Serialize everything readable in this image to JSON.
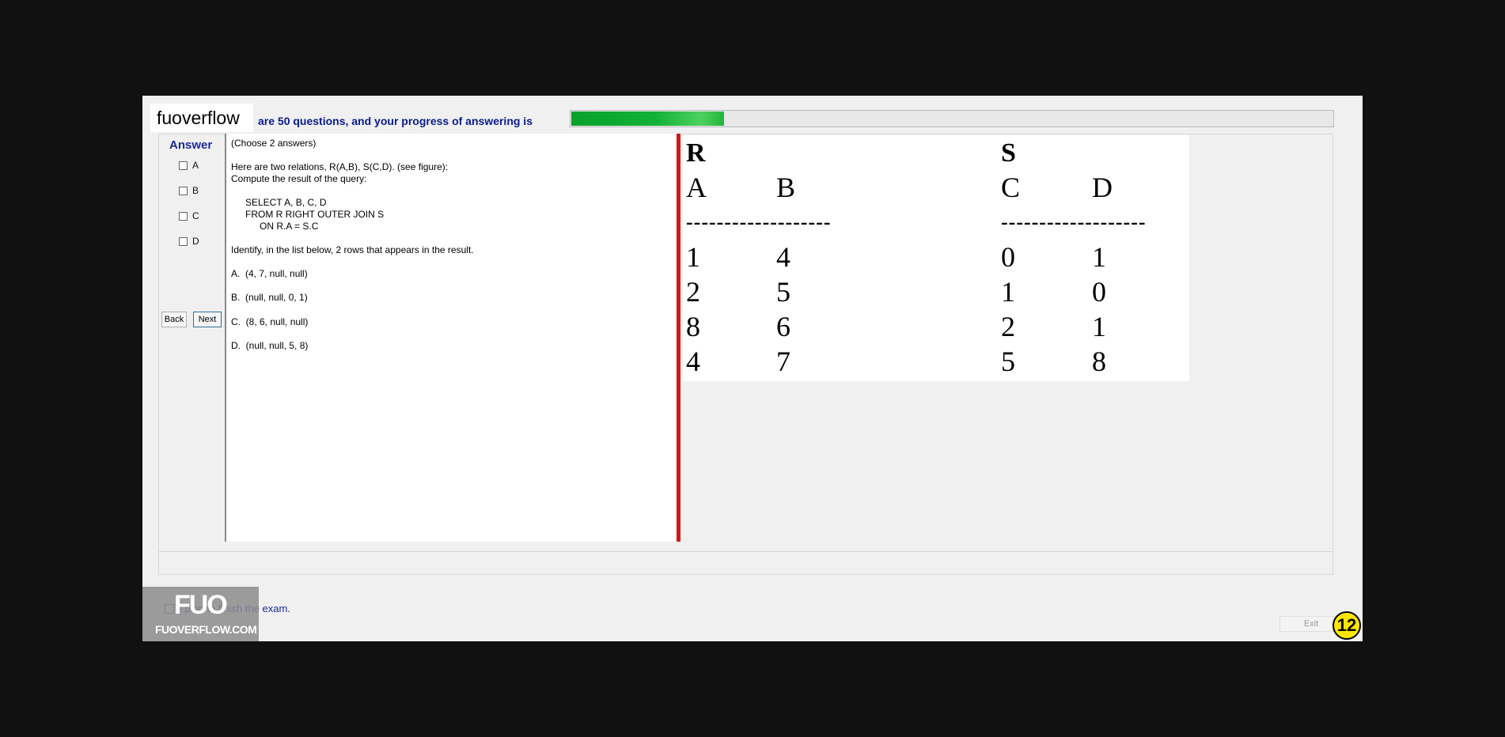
{
  "brand": {
    "text": "fuoverflow"
  },
  "header": {
    "progress_text": "are 50 questions, and your progress of answering is",
    "progress_fraction": 0.2
  },
  "answer_panel": {
    "title": "Answer",
    "options": [
      "A",
      "B",
      "C",
      "D"
    ],
    "back_label": "Back",
    "next_label": "Next"
  },
  "question": {
    "lines": [
      "(Choose 2 answers)",
      "Here are two relations, R(A,B), S(C,D). (see figure):",
      "Compute the result of the query:",
      "SELECT A, B, C, D",
      "FROM R RIGHT OUTER JOIN S",
      "ON R.A = S.C",
      "Identify, in the list below, 2 rows that appears in the result.",
      "A.  (4, 7, null, null)",
      "B.  (null, null, 0, 1)",
      "C.  (8, 6, null, null)",
      "D.  (null, null, 5, 8)"
    ]
  },
  "figure": {
    "relation_r": {
      "name": "R",
      "columns": [
        "A",
        "B"
      ],
      "rows": [
        [
          "1",
          "4"
        ],
        [
          "2",
          "5"
        ],
        [
          "8",
          "6"
        ],
        [
          "4",
          "7"
        ]
      ]
    },
    "relation_s": {
      "name": "S",
      "columns": [
        "C",
        "D"
      ],
      "rows": [
        [
          "0",
          "1"
        ],
        [
          "1",
          "0"
        ],
        [
          "2",
          "1"
        ],
        [
          "5",
          "8"
        ]
      ]
    },
    "separator": "-------------------"
  },
  "footer": {
    "finish_label": "I plan to finish the exam.",
    "logo_big": "FUO",
    "logo_small": "FUOVERFLOW.COM",
    "exit_label": "Exit",
    "question_number": "12"
  },
  "colors": {
    "progress": "#11b136",
    "accent_text": "#1b2a9e",
    "divider": "#d01818",
    "badge": "#ffe600"
  }
}
